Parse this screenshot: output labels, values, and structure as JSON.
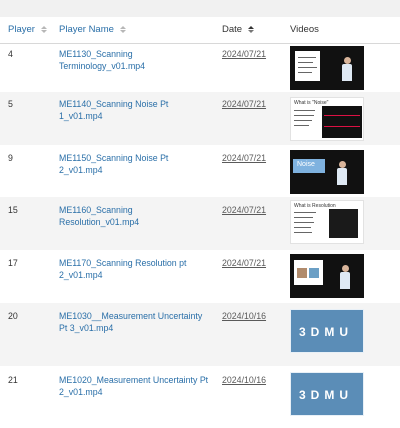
{
  "table": {
    "columns": [
      {
        "label": "Player",
        "sortable": true
      },
      {
        "label": "Player Name",
        "sortable": true
      },
      {
        "label": "Date",
        "sortable": true
      },
      {
        "label": "Videos",
        "sortable": false
      }
    ],
    "rows": [
      {
        "player": "4",
        "name": "ME1130_Scanning Terminology_v01.mp4",
        "date": "2024/07/21",
        "thumb": "dark-presenter-slide",
        "thumb_text": ""
      },
      {
        "player": "5",
        "name": "ME1140_Scanning Noise Pt 1_v01.mp4",
        "date": "2024/07/21",
        "thumb": "noise-slide",
        "thumb_text": "What is \"Noise\""
      },
      {
        "player": "9",
        "name": "ME1150_Scanning Noise Pt 2_v01.mp4",
        "date": "2024/07/21",
        "thumb": "noise-title",
        "thumb_text": "Noise"
      },
      {
        "player": "15",
        "name": "ME1160_Scanning Resolution_v01.mp4",
        "date": "2024/07/21",
        "thumb": "resolution-slide",
        "thumb_text": "What is Resolution"
      },
      {
        "player": "17",
        "name": "ME1170_Scanning Resolution pt 2_v01.mp4",
        "date": "2024/07/21",
        "thumb": "dark-presenter-images",
        "thumb_text": ""
      },
      {
        "player": "20",
        "name": "ME1030__Measurement Uncertainty Pt 3_v01.mp4",
        "date": "2024/10/16",
        "thumb": "logo",
        "thumb_text": "3DMU"
      },
      {
        "player": "21",
        "name": "ME1020_Measurement Uncertainty Pt 2_v01.mp4",
        "date": "2024/10/16",
        "thumb": "logo",
        "thumb_text": "3DMU"
      }
    ]
  },
  "colors": {
    "link": "#2a6fa8",
    "row_alt": "#f4f4f4",
    "logo_bg": "#5b8db7"
  }
}
